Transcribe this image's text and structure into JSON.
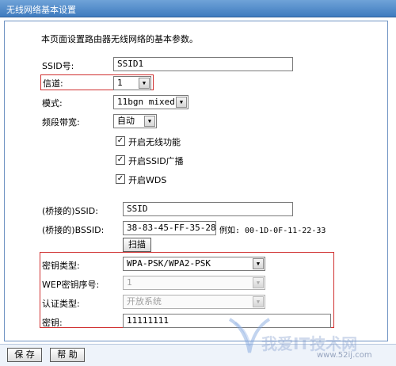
{
  "window": {
    "title": "无线网络基本设置"
  },
  "intro": "本页面设置路由器无线网络的基本参数。",
  "fields": {
    "ssid_label": "SSID号:",
    "ssid_value": "SSID1",
    "channel_label": "信道:",
    "channel_value": "1",
    "mode_label": "模式:",
    "mode_value": "11bgn mixed",
    "bandwidth_label": "频段带宽:",
    "bandwidth_value": "自动"
  },
  "checkboxes": {
    "wireless": "开启无线功能",
    "ssid_broadcast": "开启SSID广播",
    "wds": "开启WDS"
  },
  "bridge": {
    "ssid_label": "(桥接的)SSID:",
    "ssid_value": "SSID",
    "bssid_label": "(桥接的)BSSID:",
    "bssid_value": "38-83-45-FF-35-28",
    "example": "例如: 00-1D-0F-11-22-33",
    "scan_label": "扫描"
  },
  "security": {
    "key_type_label": "密钥类型:",
    "key_type_value": "WPA-PSK/WPA2-PSK",
    "wep_index_label": "WEP密钥序号:",
    "wep_index_value": "1",
    "auth_label": "认证类型:",
    "auth_value": "开放系统",
    "key_label": "密钥:",
    "key_value": "11111111"
  },
  "buttons": {
    "save": "保 存",
    "help": "帮 助"
  },
  "watermark": {
    "text": "我爱IT技术网",
    "url": "www.52ij.com"
  },
  "colors": {
    "highlight_border": "#d03030",
    "titlebar": "#3f7bbf"
  }
}
